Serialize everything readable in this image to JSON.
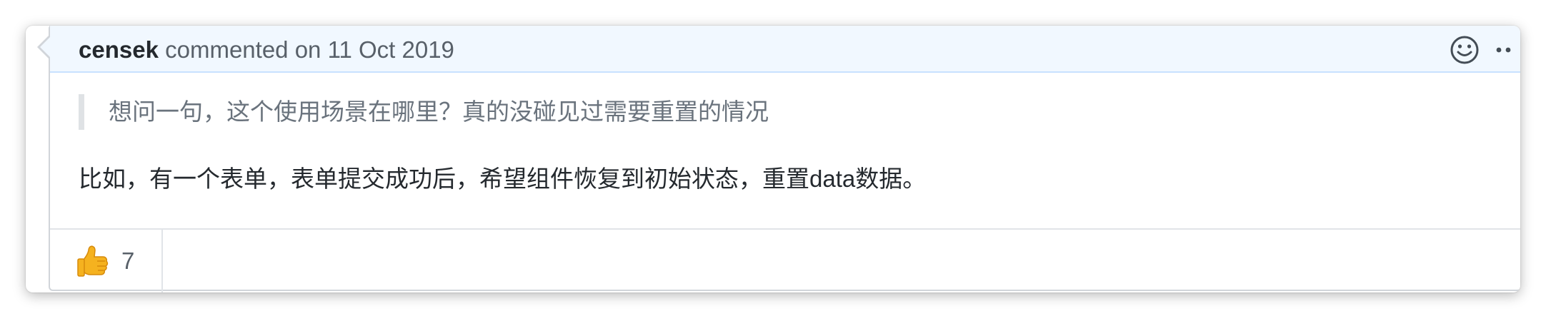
{
  "comment": {
    "author": "censek",
    "meta": "commented on 11 Oct 2019",
    "quote": "想问一句，这个使用场景在哪里？真的没碰见过需要重置的情况",
    "body": "比如，有一个表单，表单提交成功后，希望组件恢复到初始状态，重置data数据。",
    "reactions": [
      {
        "icon": "thumbs-up-icon",
        "count": "7"
      }
    ],
    "actions": {
      "emoji_icon": "smiley-icon",
      "more_icon": "kebab-horizontal-icon"
    }
  },
  "colors": {
    "header_bg": "#f1f8ff",
    "header_border": "#c8e1ff",
    "text": "#24292e",
    "muted": "#586069",
    "quote_text": "#6a737d",
    "quote_bar": "#dfe2e5"
  }
}
